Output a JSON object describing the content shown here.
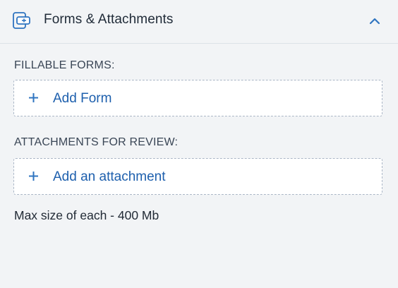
{
  "header": {
    "title": "Forms & Attachments",
    "icon": "form-attachment-icon",
    "collapse_icon": "chevron-up-icon",
    "accent_color": "#2f74c0"
  },
  "fillable_forms": {
    "label": "FILLABLE FORMS:",
    "add_button_label": "Add Form",
    "add_icon": "plus-icon"
  },
  "attachments": {
    "label": "ATTACHMENTS FOR REVIEW:",
    "add_button_label": "Add an attachment",
    "add_icon": "plus-icon"
  },
  "footer": {
    "max_size_text": "Max size of each - 400 Mb"
  }
}
